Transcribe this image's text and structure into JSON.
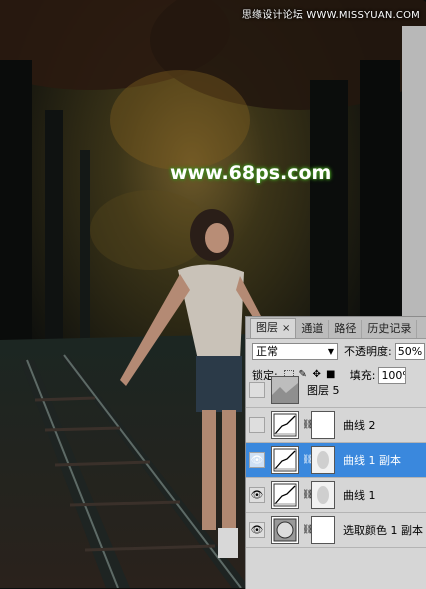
{
  "watermarks": {
    "top": "思缘设计论坛 WWW.MISSYUAN.COM",
    "center": "www.68ps.com"
  },
  "panel": {
    "tabs": [
      {
        "label": "图层",
        "close": "×",
        "active": true
      },
      {
        "label": "通道",
        "active": false
      },
      {
        "label": "路径",
        "active": false
      },
      {
        "label": "历史记录",
        "active": false
      }
    ],
    "blend_mode": "正常",
    "opacity_label": "不透明度:",
    "opacity_value": "50%",
    "lock_label": "锁定:",
    "fill_label": "填充:",
    "fill_value": "100%",
    "layers": [
      {
        "name": "图层 5",
        "visible": false,
        "selected": false,
        "thumb": "photo",
        "mask": false
      },
      {
        "name": "曲线 2",
        "visible": false,
        "selected": false,
        "thumb": "curves",
        "mask": true
      },
      {
        "name": "曲线 1 副本",
        "visible": true,
        "selected": true,
        "thumb": "curves",
        "mask": true
      },
      {
        "name": "曲线 1",
        "visible": true,
        "selected": false,
        "thumb": "curves",
        "mask": true
      },
      {
        "name": "选取颜色 1 副本",
        "visible": true,
        "selected": false,
        "thumb": "selective",
        "mask": true
      }
    ]
  },
  "colors": {
    "selection": "#3a88dd",
    "panel_bg": "#d6d6d6",
    "watermark_glow": "#3f8f1f"
  }
}
